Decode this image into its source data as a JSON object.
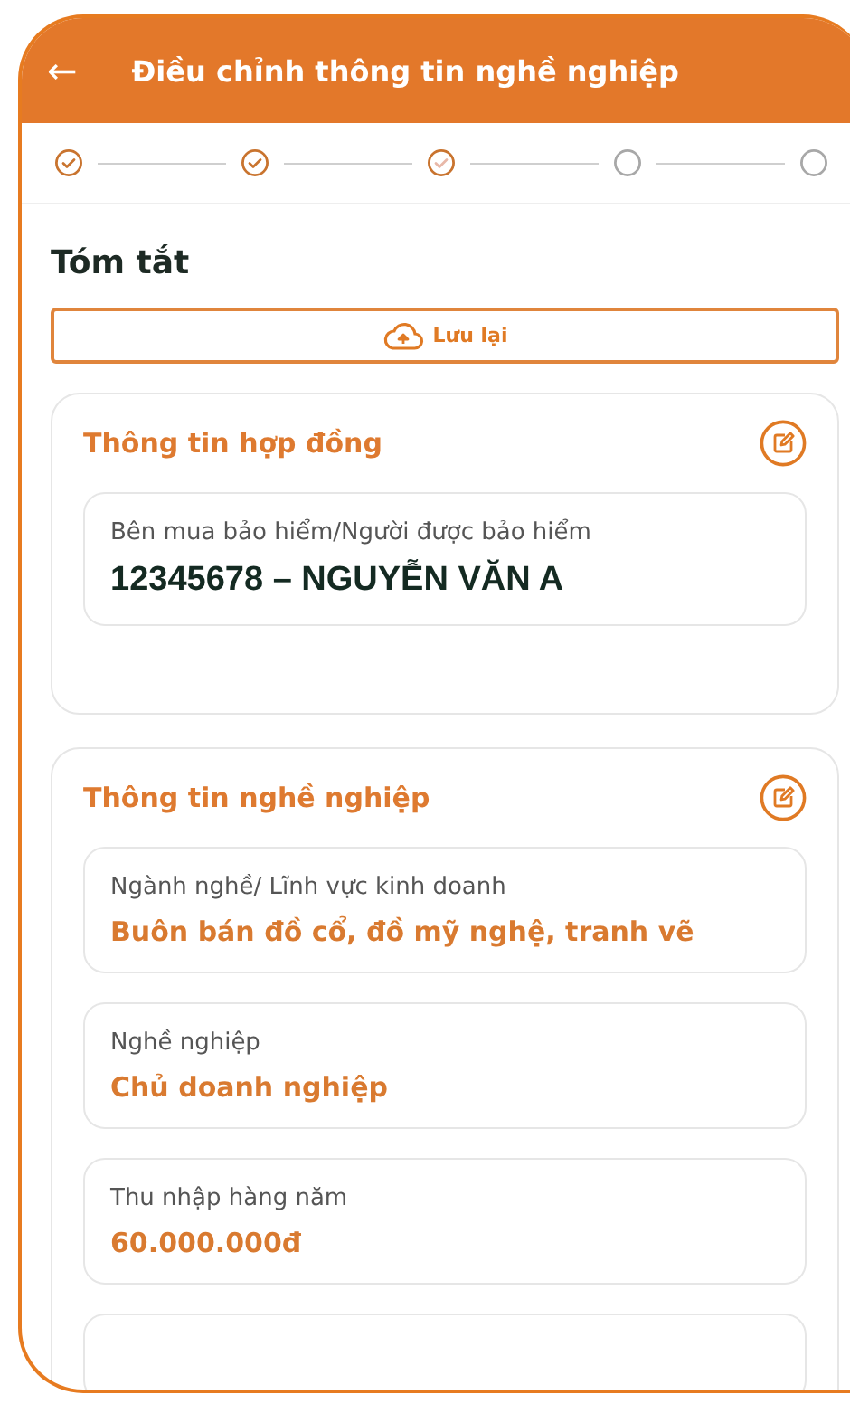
{
  "header": {
    "back": "←",
    "title": "Điều chỉnh thông tin nghề nghiệp"
  },
  "steps": [
    {
      "kind": "done"
    },
    {
      "kind": "done"
    },
    {
      "kind": "current"
    },
    {
      "kind": "pending"
    },
    {
      "kind": "pending"
    }
  ],
  "heading": "Tóm tắt",
  "save_button": {
    "label": "Lưu lại"
  },
  "sections": [
    {
      "title": "Thông tin hợp đồng",
      "fields": [
        {
          "kind": "strong",
          "label": "Bên mua bảo hiểm/Người được bảo hiểm",
          "value": "12345678 – NGUYỄN VĂN A"
        }
      ]
    },
    {
      "title": "Thông tin nghề nghiệp",
      "fields": [
        {
          "kind": "accent",
          "label": "Ngành nghề/ Lĩnh vực kinh doanh",
          "value": "Buôn bán đồ cổ, đồ mỹ nghệ, tranh vẽ"
        },
        {
          "kind": "accent",
          "label": "Nghề nghiệp",
          "value": "Chủ doanh nghiệp"
        },
        {
          "kind": "accent",
          "label": "Thu nhập hàng năm",
          "value": "60.000.000đ"
        },
        {
          "kind": "empty"
        }
      ]
    }
  ]
}
